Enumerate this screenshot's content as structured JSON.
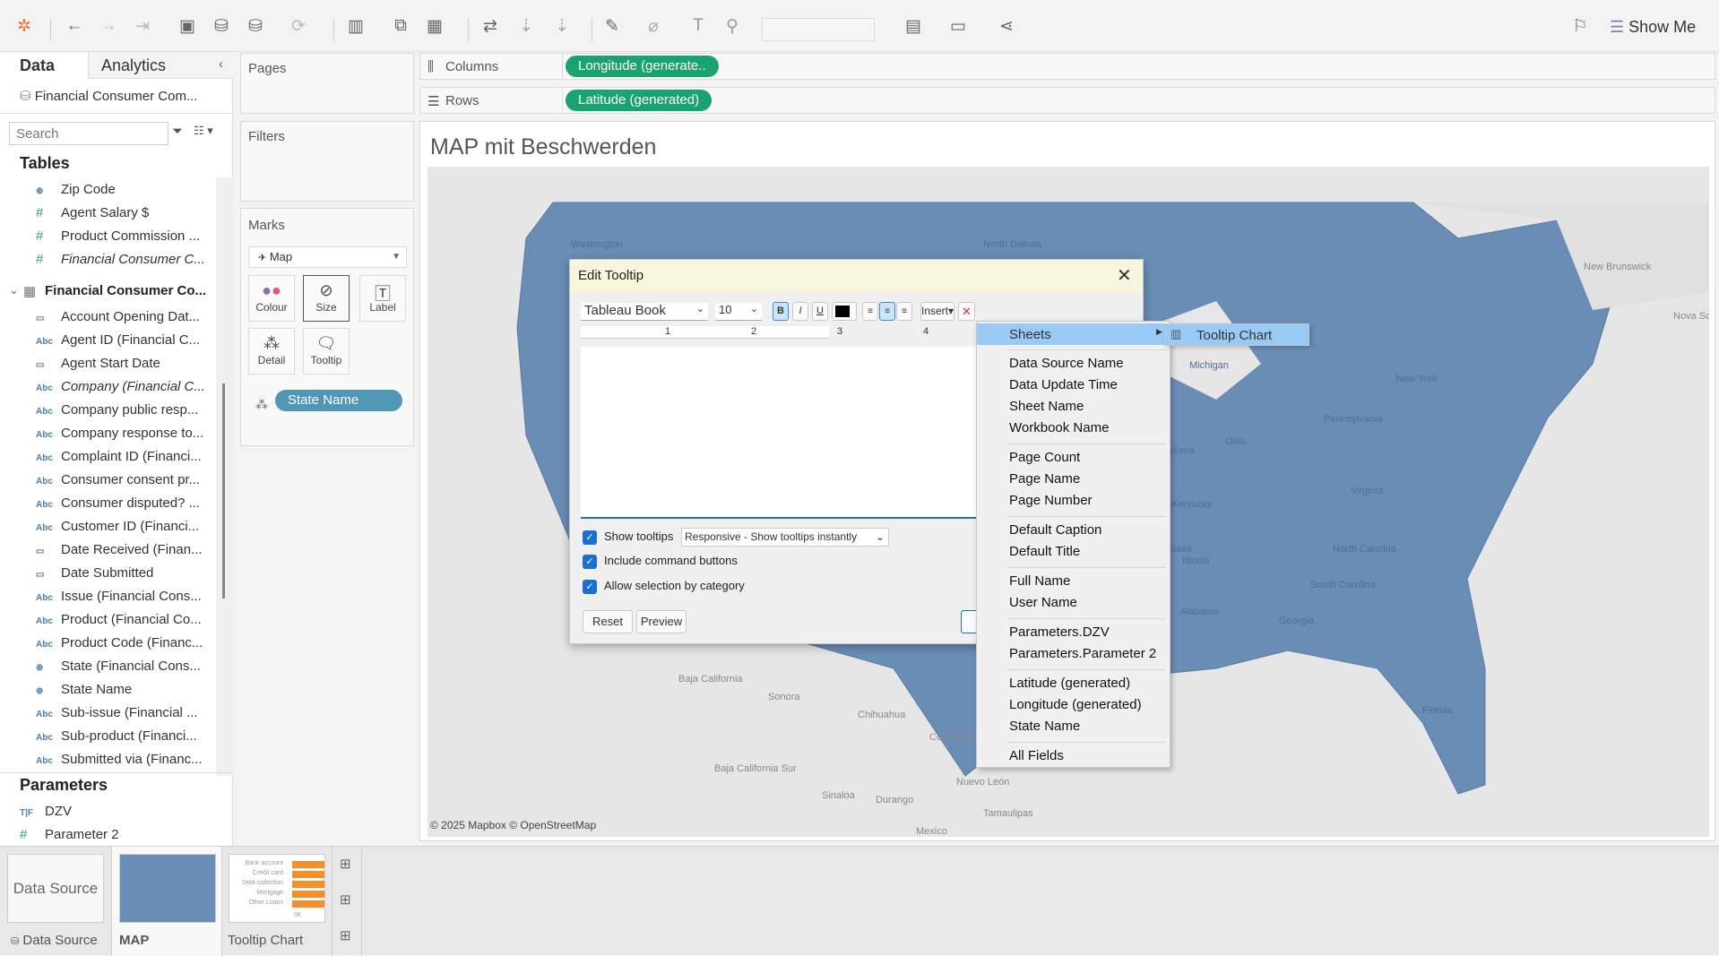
{
  "toolbar": {
    "show_me": "Show Me"
  },
  "left_panel": {
    "tabs": [
      "Data",
      "Analytics"
    ],
    "data_source": "Financial Consumer Com...",
    "search_placeholder": "Search",
    "tables_heading": "Tables",
    "fields": [
      {
        "icon": "globe",
        "label": "Zip Code"
      },
      {
        "icon": "#",
        "label": "Agent Salary $"
      },
      {
        "icon": "#",
        "label": "Product Commission ..."
      },
      {
        "icon": "#",
        "label": "Financial Consumer C..."
      }
    ],
    "table_name": "Financial Consumer Co...",
    "table_fields": [
      {
        "icon": "date",
        "label": "Account Opening Dat..."
      },
      {
        "icon": "Abc",
        "label": "Agent ID (Financial C..."
      },
      {
        "icon": "date",
        "label": "Agent Start Date"
      },
      {
        "icon": "Abc",
        "label": "Company (Financial C..."
      },
      {
        "icon": "Abc",
        "label": "Company public resp..."
      },
      {
        "icon": "Abc",
        "label": "Company response to..."
      },
      {
        "icon": "Abc",
        "label": "Complaint ID (Financi..."
      },
      {
        "icon": "Abc",
        "label": "Consumer consent pr..."
      },
      {
        "icon": "Abc",
        "label": "Consumer disputed? ..."
      },
      {
        "icon": "Abc",
        "label": "Customer ID (Financi..."
      },
      {
        "icon": "date",
        "label": "Date Received (Finan..."
      },
      {
        "icon": "date",
        "label": "Date Submitted"
      },
      {
        "icon": "Abc",
        "label": "Issue (Financial Cons..."
      },
      {
        "icon": "Abc",
        "label": "Product (Financial Co..."
      },
      {
        "icon": "Abc",
        "label": "Product Code (Financ..."
      },
      {
        "icon": "globe",
        "label": "State (Financial Cons..."
      },
      {
        "icon": "globe",
        "label": "State Name"
      },
      {
        "icon": "Abc",
        "label": "Sub-issue (Financial ..."
      },
      {
        "icon": "Abc",
        "label": "Sub-product (Financi..."
      },
      {
        "icon": "Abc",
        "label": "Submitted via (Financ..."
      }
    ],
    "parameters_heading": "Parameters",
    "parameters": [
      {
        "icon": "T|F",
        "label": "DZV"
      },
      {
        "icon": "#",
        "label": "Parameter 2"
      }
    ]
  },
  "cards": {
    "pages": "Pages",
    "filters": "Filters",
    "marks": "Marks",
    "mark_type": "Map",
    "buttons": [
      "Colour",
      "Size",
      "Label",
      "Detail",
      "Tooltip"
    ],
    "detail_pill": "State Name"
  },
  "shelves": {
    "columns_label": "Columns",
    "columns_pill": "Longitude (generate..",
    "rows_label": "Rows",
    "rows_pill": "Latitude (generated)"
  },
  "viz": {
    "title": "MAP mit Beschwerden",
    "attribution": "© 2025 Mapbox © OpenStreetMap",
    "map_labels": [
      "New Brunswick",
      "Nova Scoti",
      "Baja California",
      "Sonora",
      "Chihuahua",
      "Coahuila de Zaragoza",
      "Baja California Sur",
      "Sinaloa",
      "Durango",
      "Nuevo León",
      "Tamaulipas",
      "Mexico",
      "Michigan",
      "Illinois",
      "Indiana",
      "Ohio",
      "Kentucky",
      "Tennessee",
      "Alabama",
      "Georgia",
      "Pennsylvania",
      "New York",
      "Virginia",
      "North Carolina",
      "South Carolina",
      "Florida",
      "North Dakota",
      "Washington"
    ]
  },
  "dialog": {
    "title": "Edit Tooltip",
    "font": "Tableau Book",
    "size": "10",
    "insert": "Insert",
    "ruler": [
      "1",
      "2",
      "3",
      "4"
    ],
    "show_tooltips": "Show tooltips",
    "tooltip_mode": "Responsive - Show tooltips instantly",
    "include_command_buttons": "Include command buttons",
    "allow_selection": "Allow selection by category",
    "reset": "Reset",
    "preview": "Preview"
  },
  "insert_menu": {
    "sheets": "Sheets",
    "submenu_item": "Tooltip Chart",
    "groups": [
      [
        "Data Source Name",
        "Data Update Time",
        "Sheet Name",
        "Workbook Name"
      ],
      [
        "Page Count",
        "Page Name",
        "Page Number"
      ],
      [
        "Default Caption",
        "Default Title"
      ],
      [
        "Full Name",
        "User Name"
      ],
      [
        "Parameters.DZV",
        "Parameters.Parameter 2"
      ],
      [
        "Latitude (generated)",
        "Longitude (generated)",
        "State Name"
      ],
      [
        "All Fields"
      ]
    ]
  },
  "bottom_tabs": {
    "data_source_thumb": "Data Source",
    "data_source": "Data Source",
    "map": "MAP",
    "tooltip_chart": "Tooltip Chart",
    "thumb_chart": {
      "categories": [
        "Bank account",
        "Credit card",
        "Debt collection",
        "Mortgage",
        "Other Loans"
      ],
      "axis": "0K"
    }
  },
  "colors": {
    "accent_green": "#1aa36f",
    "dimension_blue": "#4f97b4",
    "map_fill": "#6a8db5",
    "dialog_header": "#f7f5dc",
    "menu_highlight": "#99c9f5"
  }
}
